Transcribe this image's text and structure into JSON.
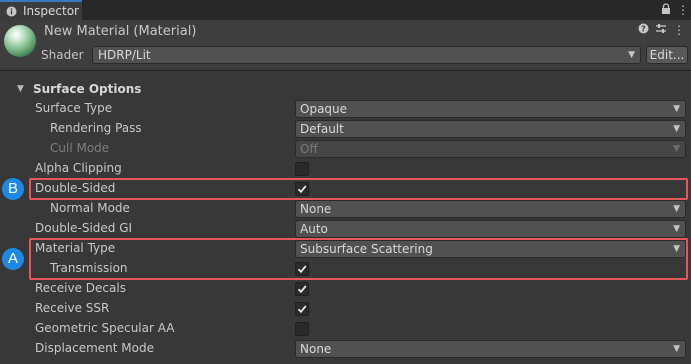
{
  "tab": {
    "label": "Inspector",
    "icon": "info-icon"
  },
  "header": {
    "title": "New Material (Material)",
    "shader_label": "Shader",
    "shader_value": "HDRP/Lit",
    "edit_label": "Edit...",
    "icons": [
      "help-icon",
      "presets-icon",
      "more-icon"
    ]
  },
  "section": {
    "title": "Surface Options",
    "expanded": true
  },
  "rows": [
    {
      "label": "Surface Type",
      "type": "dropdown",
      "value": "Opaque"
    },
    {
      "label": "Rendering Pass",
      "type": "dropdown",
      "value": "Default"
    },
    {
      "label": "Cull Mode",
      "type": "dropdown",
      "value": "Off",
      "disabled": true
    },
    {
      "label": "Alpha Clipping",
      "type": "checkbox",
      "checked": false
    },
    {
      "label": "Double-Sided",
      "type": "checkbox",
      "checked": true
    },
    {
      "label": "Normal Mode",
      "type": "dropdown",
      "value": "None"
    },
    {
      "label": "Double-Sided GI",
      "type": "dropdown",
      "value": "Auto"
    },
    {
      "label": "Material Type",
      "type": "dropdown",
      "value": "Subsurface Scattering"
    },
    {
      "label": "Transmission",
      "type": "checkbox",
      "checked": true
    },
    {
      "label": "Receive Decals",
      "type": "checkbox",
      "checked": true
    },
    {
      "label": "Receive SSR",
      "type": "checkbox",
      "checked": true
    },
    {
      "label": "Geometric Specular AA",
      "type": "checkbox",
      "checked": false
    },
    {
      "label": "Displacement Mode",
      "type": "dropdown",
      "value": "None"
    }
  ],
  "annotations": [
    {
      "badge": "B",
      "color": "#e8555a"
    },
    {
      "badge": "A",
      "color": "#e8555a"
    }
  ],
  "colors": {
    "highlight": "#e8555a",
    "badge": "#1e88e5",
    "accent_tab": "#3a79bb"
  }
}
